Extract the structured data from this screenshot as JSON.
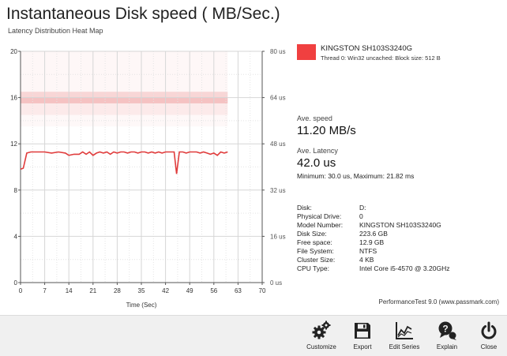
{
  "header": {
    "title": "Instantaneous Disk speed ( MB/Sec.)",
    "subtitle": "Latency Distribution Heat Map"
  },
  "legend": {
    "name": "KINGSTON SH103S3240G",
    "description": "Thread 0: Win32 uncached: Block size: 512 B",
    "color": "#f04040"
  },
  "stats": {
    "speed_label": "Ave. speed",
    "speed_value": "11.20 MB/s",
    "latency_label": "Ave. Latency",
    "latency_value": "42.0 us",
    "latency_range": "Minimum: 30.0 us, Maximum: 21.82 ms"
  },
  "info": [
    {
      "key": "Disk:",
      "value": "D:"
    },
    {
      "key": "Physical Drive:",
      "value": "0"
    },
    {
      "key": "Model Number:",
      "value": "KINGSTON SH103S3240G"
    },
    {
      "key": "Disk Size:",
      "value": "223.6 GB"
    },
    {
      "key": "Free space:",
      "value": "12.9 GB"
    },
    {
      "key": "File System:",
      "value": "NTFS"
    },
    {
      "key": "Cluster Size:",
      "value": "4 KB"
    },
    {
      "key": "CPU Type:",
      "value": "Intel Core i5-4570 @ 3.20GHz"
    }
  ],
  "footer_note": "PerformanceTest 9.0 (www.passmark.com)",
  "toolbar": [
    {
      "label": "Customize",
      "icon": "gears-icon"
    },
    {
      "label": "Export",
      "icon": "floppy-disk-icon"
    },
    {
      "label": "Edit Series",
      "icon": "line-graph-icon"
    },
    {
      "label": "Explain",
      "icon": "question-bubble-icon"
    },
    {
      "label": "Close",
      "icon": "power-icon"
    }
  ],
  "chart_data": {
    "type": "line",
    "xlabel": "Time (Sec)",
    "ylabel": "",
    "xlim": [
      0,
      70
    ],
    "ylim": [
      0,
      20
    ],
    "x_ticks": [
      "0",
      "7",
      "14",
      "21",
      "28",
      "35",
      "42",
      "49",
      "56",
      "63",
      "70"
    ],
    "y_ticks": [
      "0",
      "4",
      "8",
      "12",
      "16",
      "20"
    ],
    "y2_ticks": [
      "0 us",
      "16 us",
      "32 us",
      "48 us",
      "64 us",
      "80 us"
    ],
    "y2lim": [
      0,
      80
    ],
    "grid": true,
    "line_color": "#e03c3c",
    "series": [
      {
        "name": "KINGSTON SH103S3240G",
        "x": [
          0,
          0.8,
          1.8,
          3,
          5,
          7,
          9,
          11,
          13,
          14,
          15.5,
          17,
          18,
          19,
          20,
          21,
          22,
          23,
          24,
          25,
          26,
          27,
          28,
          29,
          30,
          31,
          32,
          33,
          34,
          35,
          36,
          37,
          38,
          39,
          40,
          41,
          42,
          43,
          44.5,
          45.2,
          46,
          47,
          48,
          49,
          50,
          51,
          52,
          53,
          54,
          55,
          56,
          57,
          58,
          59,
          60
        ],
        "y": [
          9.8,
          9.9,
          11.2,
          11.3,
          11.3,
          11.3,
          11.2,
          11.3,
          11.2,
          11.0,
          11.1,
          11.1,
          11.3,
          11.1,
          11.3,
          11.0,
          11.2,
          11.3,
          11.2,
          11.3,
          11.1,
          11.3,
          11.2,
          11.3,
          11.3,
          11.2,
          11.3,
          11.3,
          11.2,
          11.3,
          11.3,
          11.2,
          11.3,
          11.2,
          11.3,
          11.2,
          11.3,
          11.3,
          11.3,
          9.4,
          11.3,
          11.3,
          11.2,
          11.3,
          11.3,
          11.3,
          11.2,
          11.3,
          11.2,
          11.1,
          11.2,
          11.0,
          11.3,
          11.2,
          11.3
        ]
      }
    ],
    "heatmap": {
      "x_range": [
        0,
        60
      ],
      "bands": [
        {
          "y_range": [
            64,
            62
          ],
          "intensity": 0.9
        },
        {
          "y_range": [
            66,
            64
          ],
          "intensity": 0.6
        },
        {
          "y_range": [
            62,
            58
          ],
          "intensity": 0.3
        },
        {
          "y_range": [
            80,
            66
          ],
          "intensity": 0.12
        },
        {
          "y_range": [
            58,
            54
          ],
          "intensity": 0.1
        }
      ]
    }
  }
}
